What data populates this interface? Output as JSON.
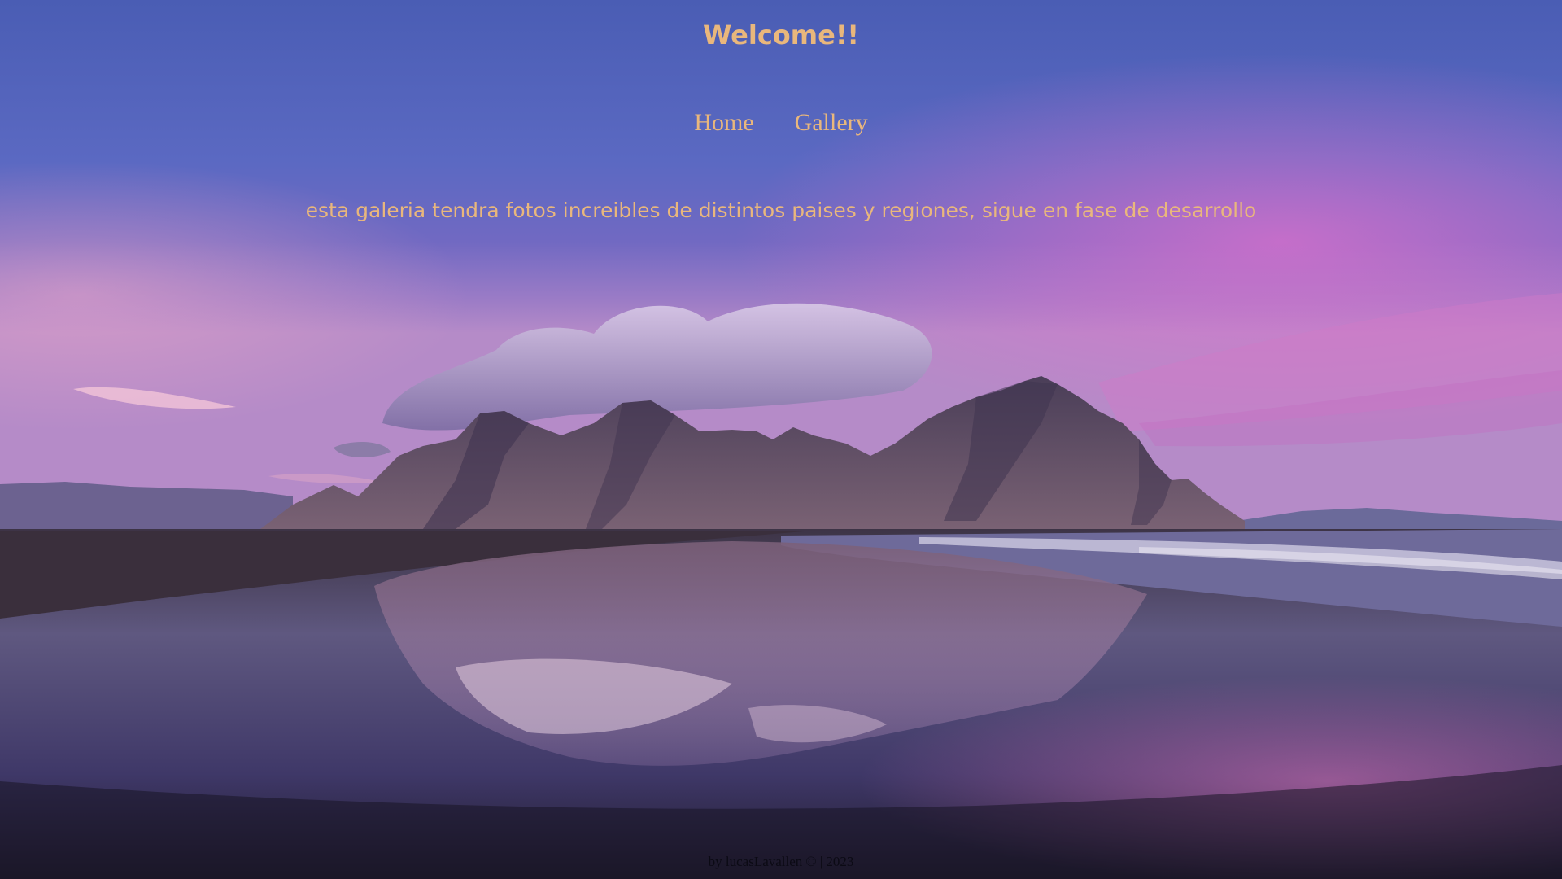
{
  "header": {
    "title": "Welcome!!"
  },
  "nav": {
    "items": [
      {
        "label": "Home"
      },
      {
        "label": "Gallery"
      }
    ]
  },
  "main": {
    "tagline": "esta galeria tendra fotos increibles de distintos paises y regiones, sigue en fase de desarrollo"
  },
  "footer": {
    "text": "by lucasLavallen © | 2023"
  },
  "colors": {
    "accent_text": "#e9b77c",
    "footer_text": "#0b0a14",
    "sky_top": "#4b5fb6",
    "sky_mid": "#6c6cc6",
    "horizon_pink": "#d07ac8",
    "mountain": "#5e5068",
    "sand_dark": "#2e2536"
  },
  "background": {
    "icon": "mountain-beach-landscape-image"
  }
}
